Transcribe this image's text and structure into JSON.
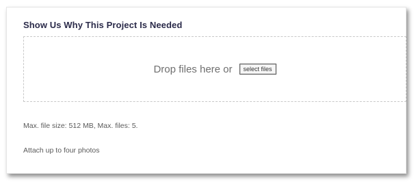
{
  "upload": {
    "label": "Show Us Why This Project Is Needed",
    "drop_text": "Drop files here or",
    "select_button": "select files",
    "limits": "Max. file size: 512 MB, Max. files: 5.",
    "description": "Attach up to four photos"
  }
}
